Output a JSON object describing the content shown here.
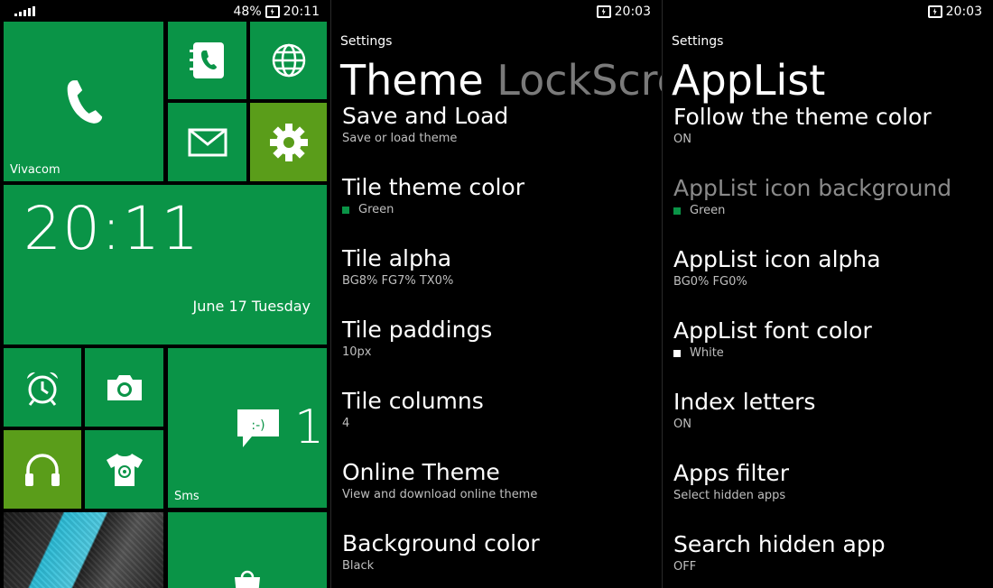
{
  "panel1": {
    "status": {
      "battery": "48%",
      "time": "20:11"
    },
    "tiles": {
      "phone_label": "Vivacom",
      "clock_time": "20:11",
      "clock_date": "June 17 Tuesday",
      "sms_label": "Sms",
      "sms_count": "1"
    },
    "colors": {
      "tile": "#0a9447",
      "accent_tile": "#5a9d1a"
    }
  },
  "panel2": {
    "status": {
      "time": "20:03"
    },
    "breadcrumb": "Settings",
    "title_active": "Theme",
    "title_next": "LockScre",
    "items": [
      {
        "title": "Save and Load",
        "sub": "Save or load theme"
      },
      {
        "title": "Tile theme color",
        "sub": "Green",
        "swatch": "#0a9447"
      },
      {
        "title": "Tile alpha",
        "sub": "BG8% FG7% TX0%"
      },
      {
        "title": "Tile paddings",
        "sub": "10px"
      },
      {
        "title": "Tile columns",
        "sub": "4"
      },
      {
        "title": "Online Theme",
        "sub": "View and download online theme"
      },
      {
        "title": "Background color",
        "sub": "Black"
      }
    ]
  },
  "panel3": {
    "status": {
      "time": "20:03"
    },
    "breadcrumb": "Settings",
    "title_active": "AppList",
    "items": [
      {
        "title": "Follow the theme color",
        "sub": "ON"
      },
      {
        "title": "AppList icon background",
        "sub": "Green",
        "swatch": "#0a9447",
        "disabled": true
      },
      {
        "title": "AppList icon alpha",
        "sub": "BG0% FG0%"
      },
      {
        "title": "AppList font color",
        "sub": "White",
        "swatch": "#ffffff"
      },
      {
        "title": "Index letters",
        "sub": "ON"
      },
      {
        "title": "Apps filter",
        "sub": "Select hidden apps"
      },
      {
        "title": "Search hidden app",
        "sub": "OFF"
      }
    ]
  }
}
